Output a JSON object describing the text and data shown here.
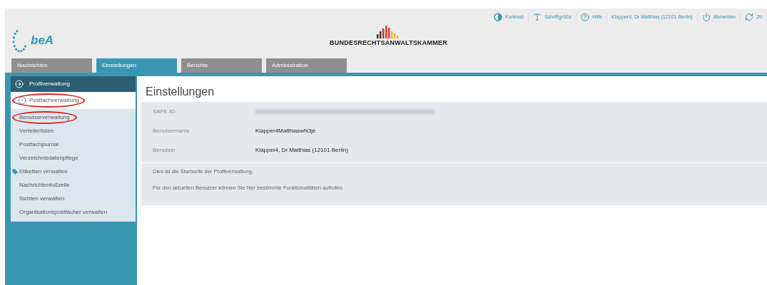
{
  "header": {
    "logo_text": "beA",
    "brand": "BUNDESRECHTSANWALTSKAMMER",
    "links": [
      {
        "kind": "contrast",
        "label": "Kontrast"
      },
      {
        "kind": "font",
        "label": "Schriftgröße"
      },
      {
        "kind": "help",
        "label": "Hilfe"
      },
      {
        "kind": "plain",
        "label": "Klapper4, Dr Matthias (12101 Berlin)"
      },
      {
        "kind": "power",
        "label": "Abmelden"
      },
      {
        "kind": "timer",
        "label": "29"
      }
    ]
  },
  "tabs": [
    {
      "label": "Nachrichten",
      "selected": false
    },
    {
      "label": "Einstellungen",
      "selected": true
    },
    {
      "label": "Berichte",
      "selected": false
    },
    {
      "label": "Administration",
      "selected": false
    }
  ],
  "sidebar": {
    "title": "Profilverwaltung",
    "section": {
      "label": "Postfachverwaltung",
      "circled": true
    },
    "items": [
      {
        "label": "Benutzerverwaltung",
        "kind": "plain",
        "circled": true
      },
      {
        "label": "Verteilerlisten",
        "kind": "plain",
        "circled": false
      },
      {
        "label": "Postfachjournal",
        "kind": "plain",
        "circled": false
      },
      {
        "label": "Verzeichnisdatenpflege",
        "kind": "plain",
        "circled": false
      },
      {
        "label": "Etiketten verwalten",
        "kind": "tag",
        "circled": false
      },
      {
        "label": "Nachrichtenfußzeile",
        "kind": "plain",
        "circled": false
      },
      {
        "label": "Sichten verwalten",
        "kind": "plain",
        "circled": false
      },
      {
        "label": "Organisationspostfächer verwalten",
        "kind": "plain",
        "circled": false
      }
    ]
  },
  "content": {
    "title": "Einstellungen",
    "fields": [
      {
        "label": "SAFE-ID",
        "kind": "redacted"
      },
      {
        "label": "Benutzername",
        "kind": "text",
        "value": "Klapper4MatthiaswN3je"
      },
      {
        "label": "Benutzer",
        "kind": "text",
        "value": "Klapper4, Dr Matthias (12101 Berlin)"
      }
    ],
    "paragraphs": [
      "Dies ist die Startseite der Profilverwaltung.",
      "Für den aktuellen Benutzer können Sie hier bestimmte Funktionalitäten aufrufen."
    ]
  }
}
